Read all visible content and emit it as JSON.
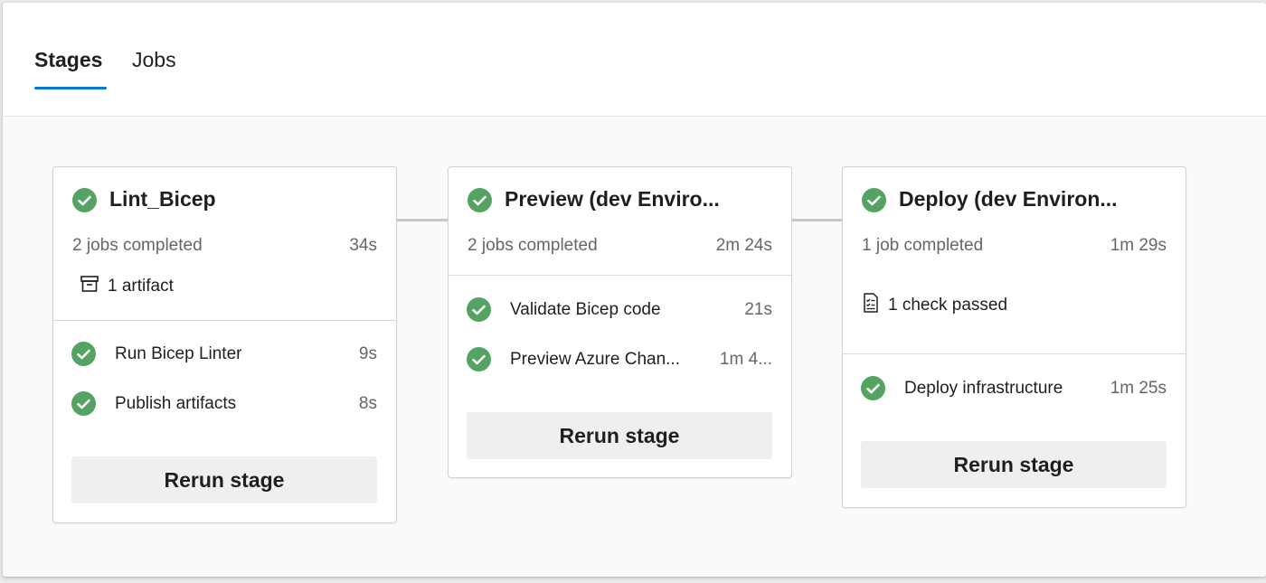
{
  "tabs": [
    {
      "label": "Stages",
      "active": true
    },
    {
      "label": "Jobs",
      "active": false
    }
  ],
  "colors": {
    "accent": "#0078d4",
    "success": "#55a362"
  },
  "stages": [
    {
      "title": "Lint_Bicep",
      "status_icon": "success-check-icon",
      "jobs_summary": "2 jobs completed",
      "duration": "34s",
      "extra": {
        "icon": "artifact-icon",
        "label": "1 artifact"
      },
      "jobs": [
        {
          "name": "Run Bicep Linter",
          "duration": "9s"
        },
        {
          "name": "Publish artifacts",
          "duration": "8s"
        }
      ],
      "rerun_label": "Rerun stage"
    },
    {
      "title": "Preview (dev Enviro...",
      "status_icon": "success-check-icon",
      "jobs_summary": "2 jobs completed",
      "duration": "2m 24s",
      "jobs": [
        {
          "name": "Validate Bicep code",
          "duration": "21s"
        },
        {
          "name": "Preview Azure Chan...",
          "duration": "1m 4..."
        }
      ],
      "rerun_label": "Rerun stage"
    },
    {
      "title": "Deploy (dev Environ...",
      "status_icon": "success-check-icon",
      "jobs_summary": "1 job completed",
      "duration": "1m 29s",
      "extra": {
        "icon": "checklist-icon",
        "label": "1 check passed"
      },
      "jobs": [
        {
          "name": "Deploy infrastructure",
          "duration": "1m 25s"
        }
      ],
      "rerun_label": "Rerun stage"
    }
  ]
}
